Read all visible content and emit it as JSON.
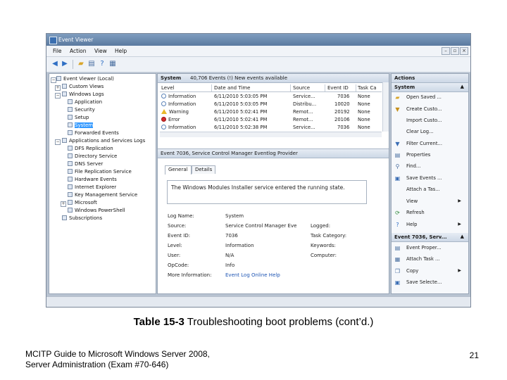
{
  "window": {
    "title": "Event Viewer",
    "accent": "#5b7aa0"
  },
  "menu": [
    {
      "label": "File"
    },
    {
      "label": "Action"
    },
    {
      "label": "View"
    },
    {
      "label": "Help"
    }
  ],
  "toolbar_icons": [
    "back-icon",
    "forward-icon",
    "folder-icon",
    "properties-icon",
    "help-icon",
    "view-icon"
  ],
  "tree": {
    "root": "Event Viewer (Local)",
    "custom_views": "Custom Views",
    "windows_logs": "Windows Logs",
    "windows_logs_children": [
      "Application",
      "Security",
      "Setup",
      "System",
      "Forwarded Events"
    ],
    "apps_services": "Applications and Services Logs",
    "apps_children": [
      "DFS Replication",
      "Directory Service",
      "DNS Server",
      "File Replication Service",
      "Hardware Events",
      "Internet Explorer",
      "Key Management Service",
      "Microsoft",
      "Windows PowerShell"
    ],
    "subscriptions": "Subscriptions"
  },
  "events_pane": {
    "title": "System",
    "summary": "40,706 Events (!) New events available",
    "columns": [
      "Level",
      "Date and Time",
      "Source",
      "Event ID",
      "Task Ca"
    ],
    "rows": [
      {
        "level": "Information",
        "icon": "info-icon",
        "date": "6/11/2010 5:03:05 PM",
        "source": "Service...",
        "id": "7036",
        "task": "None"
      },
      {
        "level": "Information",
        "icon": "info-icon",
        "date": "6/11/2010 5:03:05 PM",
        "source": "Distribu...",
        "id": "10020",
        "task": "None"
      },
      {
        "level": "Warning",
        "icon": "warning-icon",
        "date": "6/11/2010 5:02:41 PM",
        "source": "Remot...",
        "id": "20192",
        "task": "None"
      },
      {
        "level": "Error",
        "icon": "error-icon",
        "date": "6/11/2010 5:02:41 PM",
        "source": "Remot...",
        "id": "20106",
        "task": "None"
      },
      {
        "level": "Information",
        "icon": "info-icon",
        "date": "6/11/2010 5:02:38 PM",
        "source": "Service...",
        "id": "7036",
        "task": "None"
      }
    ]
  },
  "details": {
    "header": "Event 7036, Service Control Manager Eventlog Provider",
    "tabs": [
      "General",
      "Details"
    ],
    "message": "The Windows Modules Installer service entered the running state.",
    "log_name_label": "Log Name:",
    "log_name": "System",
    "source_label": "Source:",
    "source": "Service Control Manager Eve",
    "logged_label": "Logged:",
    "event_id_label": "Event ID:",
    "event_id": "7036",
    "task_category_label": "Task Category:",
    "level_label": "Level:",
    "level": "Information",
    "keywords_label": "Keywords:",
    "user_label": "User:",
    "user": "N/A",
    "computer_label": "Computer:",
    "opcode_label": "OpCode:",
    "opcode": "Info",
    "more_info_label": "More Information:",
    "more_info_link": "Event Log Online Help"
  },
  "actions": {
    "header": "Actions",
    "section1": "System",
    "items1": [
      {
        "label": "Open Saved ...",
        "icon": "folder-icon"
      },
      {
        "label": "Create Custo...",
        "icon": "filter-icon"
      },
      {
        "label": "Import Custo...",
        "icon": "import-icon"
      },
      {
        "label": "Clear Log...",
        "icon": "clear-icon"
      },
      {
        "label": "Filter Current...",
        "icon": "filter-icon"
      },
      {
        "label": "Properties",
        "icon": "properties-icon"
      },
      {
        "label": "Find...",
        "icon": "find-icon"
      },
      {
        "label": "Save Events ...",
        "icon": "save-icon"
      },
      {
        "label": "Attach a Tas...",
        "icon": "task-icon"
      },
      {
        "label": "View",
        "icon": "view-icon",
        "submenu": true
      },
      {
        "label": "Refresh",
        "icon": "refresh-icon"
      },
      {
        "label": "Help",
        "icon": "help-icon",
        "submenu": true
      }
    ],
    "section2": "Event 7036, Serv...",
    "items2": [
      {
        "label": "Event Proper...",
        "icon": "event-properties-icon"
      },
      {
        "label": "Attach Task ...",
        "icon": "task-icon"
      },
      {
        "label": "Copy",
        "icon": "copy-icon",
        "submenu": true
      },
      {
        "label": "Save Selecte...",
        "icon": "save-icon"
      }
    ]
  },
  "slide": {
    "caption_bold": "Table 15-3",
    "caption_rest": " Troubleshooting boot problems (cont’d.)",
    "footer_line1": "MCITP Guide to Microsoft Windows Server 2008,",
    "footer_line2": "Server Administration (Exam #70-646)",
    "page_number": "21"
  }
}
